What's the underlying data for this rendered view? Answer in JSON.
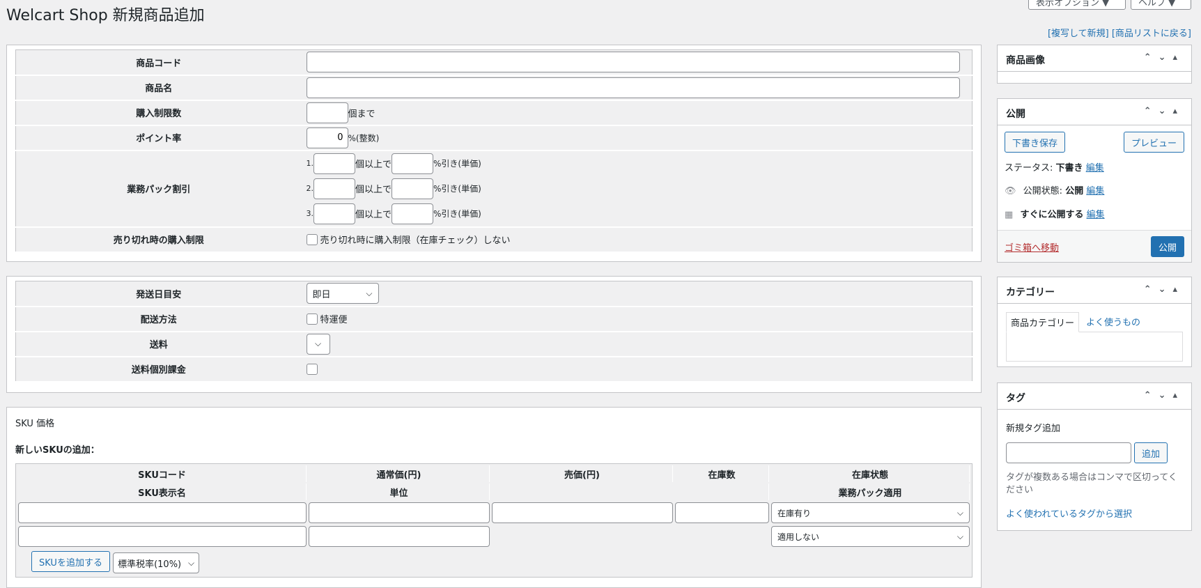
{
  "page": {
    "title": "Welcart Shop 新規商品追加",
    "screen_options": "表示オプション ▼",
    "help": "ヘルプ ▼",
    "link_copy": "[複写して新規]",
    "link_list": "[商品リストに戻る]"
  },
  "product": {
    "code_label": "商品コード",
    "name_label": "商品名",
    "limit_label": "購入制限数",
    "limit_unit": "個まで",
    "point_label": "ポイント率",
    "point_value": "0",
    "point_unit": "%(整数)",
    "pack_label": "業務パック割引",
    "pack_rows": [
      {
        "num": "1.",
        "unit1": "個以上で",
        "unit2": "%引き(単価)"
      },
      {
        "num": "2.",
        "unit1": "個以上で",
        "unit2": "%引き(単価)"
      },
      {
        "num": "3.",
        "unit1": "個以上で",
        "unit2": "%引き(単価)"
      }
    ],
    "soldout_label": "売り切れ時の購入制限",
    "soldout_text": "売り切れ時に購入制限（在庫チェック）しない"
  },
  "shipping": {
    "eta_label": "発送日目安",
    "eta_value": "即日",
    "method_label": "配送方法",
    "method_option": "特運便",
    "fee_label": "送料",
    "individual_label": "送料個別課金"
  },
  "sku": {
    "section_title": "SKU 価格",
    "add_title": "新しいSKUの追加：",
    "headers_row1": [
      "SKUコード",
      "通常価(円)",
      "売価(円)",
      "在庫数",
      "在庫状態"
    ],
    "headers_row2": [
      "SKU表示名",
      "単位",
      "",
      "",
      "業務パック適用"
    ],
    "stock_status": "在庫有り",
    "pack_apply": "適用しない",
    "add_button": "SKUを追加する",
    "tax_select": "標準税率(10%)"
  },
  "sidebar": {
    "image_title": "商品画像",
    "publish": {
      "title": "公開",
      "draft_button": "下書き保存",
      "preview_button": "プレビュー",
      "status_label": "ステータス:",
      "status_value": "下書き",
      "edit": "編集",
      "visibility_label": "公開状態:",
      "visibility_value": "公開",
      "schedule_text": "すぐに公開する",
      "trash": "ゴミ箱へ移動",
      "publish_button": "公開"
    },
    "category": {
      "title": "カテゴリー",
      "tab_all": "商品カテゴリー",
      "tab_popular": "よく使うもの"
    },
    "tags": {
      "title": "タグ",
      "new_label": "新規タグ追加",
      "add_button": "追加",
      "hint": "タグが複数ある場合はコンマで区切ってください",
      "choose_link": "よく使われているタグから選択"
    }
  }
}
